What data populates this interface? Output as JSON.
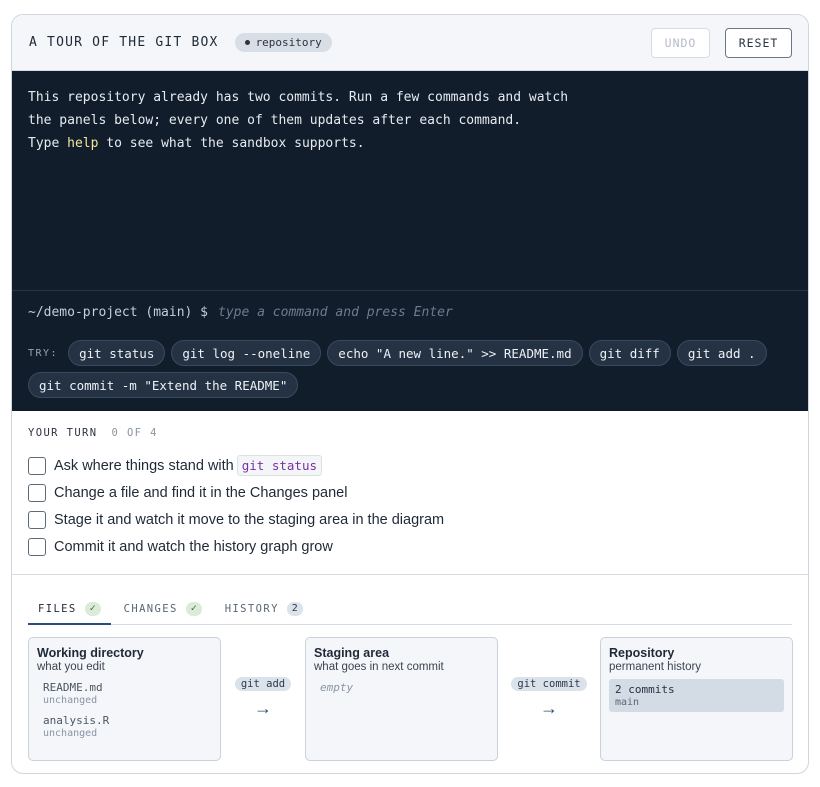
{
  "header": {
    "title": "A TOUR OF THE GIT BOX",
    "badge": "repository",
    "undo_label": "UNDO",
    "reset_label": "RESET"
  },
  "terminal": {
    "lines": [
      "This repository already has two commits. Run a few commands and watch",
      "the panels below; every one of them updates after each command."
    ],
    "line3_pre": "Type ",
    "line3_kw": "help",
    "line3_post": " to see what the sandbox supports.",
    "prompt": "~/demo-project (main) $",
    "input_placeholder": "type a command and press Enter",
    "input_value": "",
    "try_label": "TRY:",
    "suggestions": [
      "git status",
      "git log --oneline",
      "echo \"A new line.\" >> README.md",
      "git diff",
      "git add .",
      "git commit -m \"Extend the README\""
    ]
  },
  "your_turn": {
    "title": "YOUR TURN",
    "progress": "0 OF 4",
    "tasks": [
      {
        "text": "Ask where things stand with",
        "code": "git status",
        "done": false
      },
      {
        "text": "Change a file and find it in the Changes panel",
        "done": false
      },
      {
        "text": "Stage it and watch it move to the staging area in the diagram",
        "done": false
      },
      {
        "text": "Commit it and watch the history graph grow",
        "done": false
      }
    ]
  },
  "tabs": [
    {
      "label": "FILES",
      "badge": "✓",
      "active": true
    },
    {
      "label": "CHANGES",
      "badge": "✓",
      "active": false
    },
    {
      "label": "HISTORY",
      "badge": "2",
      "active": false
    }
  ],
  "diagram": {
    "working": {
      "title": "Working directory",
      "subtitle": "what you edit",
      "files": [
        {
          "name": "README.md",
          "state": "unchanged"
        },
        {
          "name": "analysis.R",
          "state": "unchanged"
        }
      ]
    },
    "add_label": "git add",
    "staging": {
      "title": "Staging area",
      "subtitle": "what goes in next commit",
      "empty_text": "empty"
    },
    "commit_label": "git commit",
    "repository": {
      "title": "Repository",
      "subtitle": "permanent history",
      "commits": "2 commits",
      "branch": "main"
    },
    "arrow": "→"
  }
}
